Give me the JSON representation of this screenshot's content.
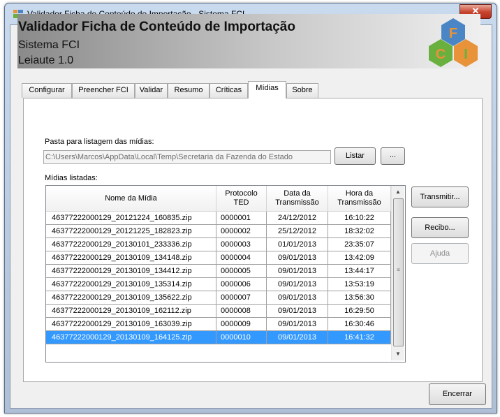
{
  "window": {
    "title": "Validador Ficha de Conteúdo de Importação - Sistema FCI",
    "close_label": "✕"
  },
  "header": {
    "title": "Validador Ficha de Conteúdo de Importação",
    "subtitle": "Sistema FCI",
    "layout_label": "Leiaute 1.0",
    "logo_letters": [
      "F",
      "C",
      "I"
    ]
  },
  "tabs": [
    "Configurar",
    "Preencher FCI",
    "Validar",
    "Resumo",
    "Críticas",
    "Mídias",
    "Sobre"
  ],
  "active_tab": "Mídias",
  "media": {
    "folder_label": "Pasta para listagem das mídias:",
    "folder_path": "C:\\Users\\Marcos\\AppData\\Local\\Temp\\Secretaria da Fazenda do Estado",
    "list_button": "Listar",
    "browse_button": "...",
    "listed_label": "Mídias listadas:"
  },
  "table": {
    "columns": [
      "Nome da Mídia",
      "Protocolo TED",
      "Data da Transmissão",
      "Hora da Transmissão"
    ],
    "rows": [
      [
        "46377222000129_20121224_160835.zip",
        "0000001",
        "24/12/2012",
        "16:10:22"
      ],
      [
        "46377222000129_20121225_182823.zip",
        "0000002",
        "25/12/2012",
        "18:32:02"
      ],
      [
        "46377222000129_20130101_233336.zip",
        "0000003",
        "01/01/2013",
        "23:35:07"
      ],
      [
        "46377222000129_20130109_134148.zip",
        "0000004",
        "09/01/2013",
        "13:42:09"
      ],
      [
        "46377222000129_20130109_134412.zip",
        "0000005",
        "09/01/2013",
        "13:44:17"
      ],
      [
        "46377222000129_20130109_135314.zip",
        "0000006",
        "09/01/2013",
        "13:53:19"
      ],
      [
        "46377222000129_20130109_135622.zip",
        "0000007",
        "09/01/2013",
        "13:56:30"
      ],
      [
        "46377222000129_20130109_162112.zip",
        "0000008",
        "09/01/2013",
        "16:29:50"
      ],
      [
        "46377222000129_20130109_163039.zip",
        "0000009",
        "09/01/2013",
        "16:30:46"
      ],
      [
        "46377222000129_20130109_164125.zip",
        "0000010",
        "09/01/2013",
        "16:41:32"
      ]
    ],
    "selected_row": 9
  },
  "actions": {
    "transmit": "Transmitir...",
    "receipt": "Recibo...",
    "help": "Ajuda"
  },
  "footer": {
    "close_button": "Encerrar"
  },
  "colors": {
    "selection": "#3399ff",
    "logo_f": "#4a86c5",
    "logo_c": "#6ab03e",
    "logo_i": "#e8923a"
  }
}
